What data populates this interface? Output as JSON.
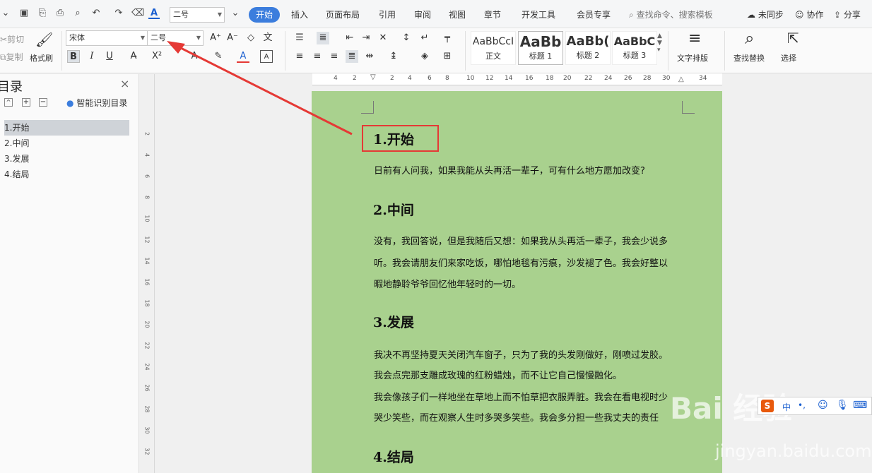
{
  "menubar": {
    "font_size": "二号",
    "tabs": [
      "开始",
      "插入",
      "页面布局",
      "引用",
      "审阅",
      "视图",
      "章节",
      "开发工具",
      "会员专享"
    ],
    "search_placeholder": "查找命令、搜索模板",
    "right": {
      "sync": "未同步",
      "collab": "协作",
      "share": "分享"
    }
  },
  "ribbon": {
    "cut": "剪切",
    "copy": "复制",
    "format_painter": "格式刷",
    "font_name": "宋体",
    "font_size": "二号",
    "bold": "B",
    "italic": "I",
    "underline": "U",
    "styles": [
      {
        "preview": "AaBbCcI",
        "name": "正文"
      },
      {
        "preview": "AaBb",
        "name": "标题 1"
      },
      {
        "preview": "AaBb(",
        "name": "标题 2"
      },
      {
        "preview": "AaBbC",
        "name": "标题 3"
      }
    ],
    "text_layout": "文字排版",
    "find_replace": "查找替换",
    "select": "选择"
  },
  "toc": {
    "title": "目录",
    "smart_label": "智能识别目录",
    "items": [
      "1.开始",
      "2.中间",
      "3.发展",
      "4.结局"
    ]
  },
  "hruler_ticks": [
    "4",
    "2",
    "2",
    "4",
    "6",
    "8",
    "10",
    "12",
    "14",
    "16",
    "18",
    "20",
    "22",
    "24",
    "26",
    "28",
    "30",
    "34"
  ],
  "vruler_ticks": [
    "2",
    "4",
    "6",
    "8",
    "10",
    "12",
    "14",
    "16",
    "18",
    "20",
    "22",
    "24",
    "26",
    "28",
    "30",
    "32"
  ],
  "document": {
    "h1": "1.开始",
    "p1": "日前有人问我，如果我能从头再活一辈子，可有什么地方愿加改变?",
    "h2": "2.中间",
    "p2a": "没有，我回答说，但是我随后又想：如果我从头再活一辈子，我会少说多",
    "p2b": "听。我会请朋友们来家吃饭，哪怕地毯有污痕，沙发褪了色。我会好整以",
    "p2c": "暇地静聆爷爷回忆他年轻时的一切。",
    "h3": "3.发展",
    "p3a": "我决不再坚持夏天关闭汽车窗子，只为了我的头发刚做好，刚喷过发胶。",
    "p3b": "我会点完那支雕成玫瑰的红粉蜡烛，而不让它自己慢慢融化。",
    "p3c": "我会像孩子们一样地坐在草地上而不怕草把衣服弄脏。我会在看电视时少",
    "p3d": "哭少笑些，而在观察人生时多哭多笑些。我会多分担一些我丈夫的责任",
    "h4": "4.结局"
  },
  "ime": {
    "lang": "中",
    "punct": "•,"
  },
  "watermark": {
    "main": "Bai 经验",
    "sub": "jingyan.baidu.com"
  },
  "colors": {
    "accent": "#3b7ddd",
    "page_bg": "#a9d18e",
    "highlight": "#e53935"
  }
}
